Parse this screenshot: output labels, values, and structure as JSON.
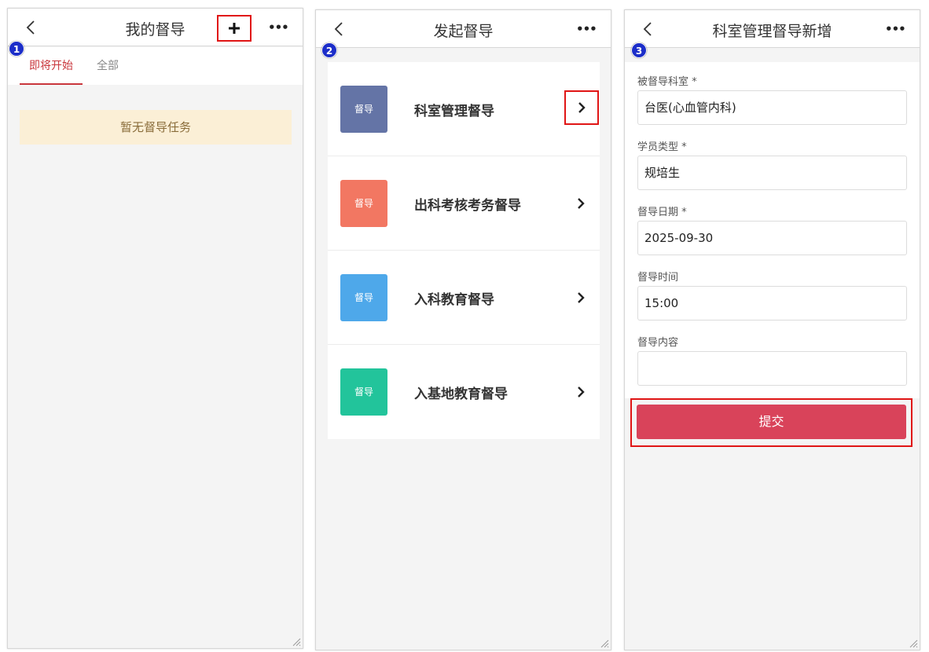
{
  "panel1": {
    "step": "1",
    "title": "我的督导",
    "add_icon": "plus-icon",
    "more_label": "•••",
    "tabs": [
      {
        "label": "即将开始",
        "active": true
      },
      {
        "label": "全部",
        "active": false
      }
    ],
    "empty_message": "暂无督导任务"
  },
  "panel2": {
    "step": "2",
    "title": "发起督导",
    "more_label": "•••",
    "items": [
      {
        "tile_label": "督导",
        "label": "科室管理督导",
        "color": "#6474a6"
      },
      {
        "tile_label": "督导",
        "label": "出科考核考务督导",
        "color": "#f27762"
      },
      {
        "tile_label": "督导",
        "label": "入科教育督导",
        "color": "#4ea8ea"
      },
      {
        "tile_label": "督导",
        "label": "入基地教育督导",
        "color": "#22c49b"
      }
    ]
  },
  "panel3": {
    "step": "3",
    "title": "科室管理督导新增",
    "more_label": "•••",
    "fields": [
      {
        "label": "被督导科室 *",
        "value": "台医(心血管内科)"
      },
      {
        "label": "学员类型 *",
        "value": "规培生"
      },
      {
        "label": "督导日期 *",
        "value": "2025-09-30"
      },
      {
        "label": "督导时间",
        "value": "15:00"
      },
      {
        "label": "督导内容",
        "value": ""
      }
    ],
    "submit_label": "提交"
  },
  "colors": {
    "accent_red": "#c9363c",
    "submit_red": "#d9435a",
    "highlight_box": "#e01515",
    "step_badge": "#1c2ec9"
  }
}
